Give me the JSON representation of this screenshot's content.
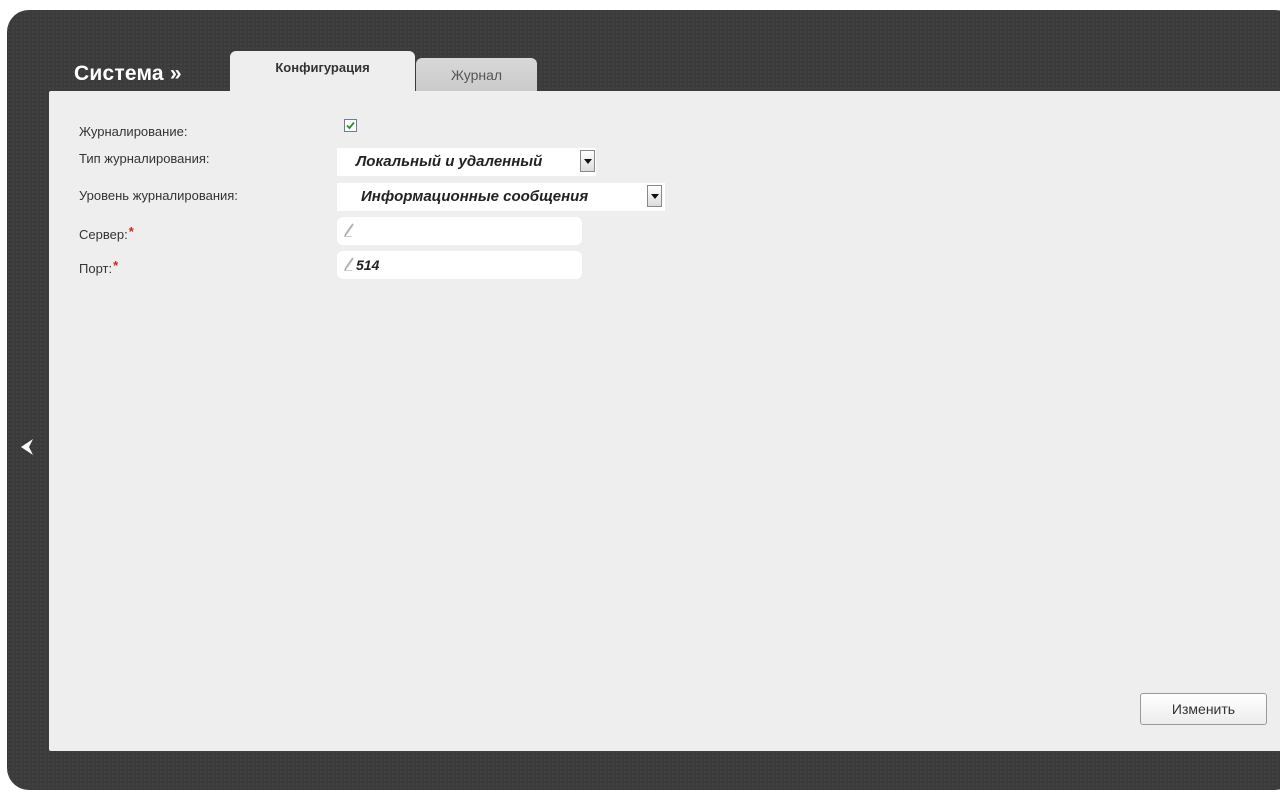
{
  "header": {
    "section_title": "Система »",
    "tabs": [
      {
        "label": "Конфигурация",
        "active": true
      },
      {
        "label": "Журнал",
        "active": false
      }
    ]
  },
  "form": {
    "logging": {
      "label": "Журналирование:",
      "checked": true
    },
    "log_type": {
      "label": "Тип журналирования:",
      "value": "Локальный и удаленный"
    },
    "log_level": {
      "label": "Уровень журналирования:",
      "value": "Информационные сообщения"
    },
    "server": {
      "label": "Сервер:",
      "required_mark": "*",
      "value": ""
    },
    "port": {
      "label": "Порт:",
      "required_mark": "*",
      "value": "514"
    }
  },
  "actions": {
    "apply_label": "Изменить"
  },
  "nav": {
    "back_icon": "chevron-left-icon"
  },
  "colors": {
    "frame": "#3b3b3b",
    "panel": "#eeeeee",
    "required": "#d9221d",
    "checkbox_mark": "#2e8b2e"
  }
}
